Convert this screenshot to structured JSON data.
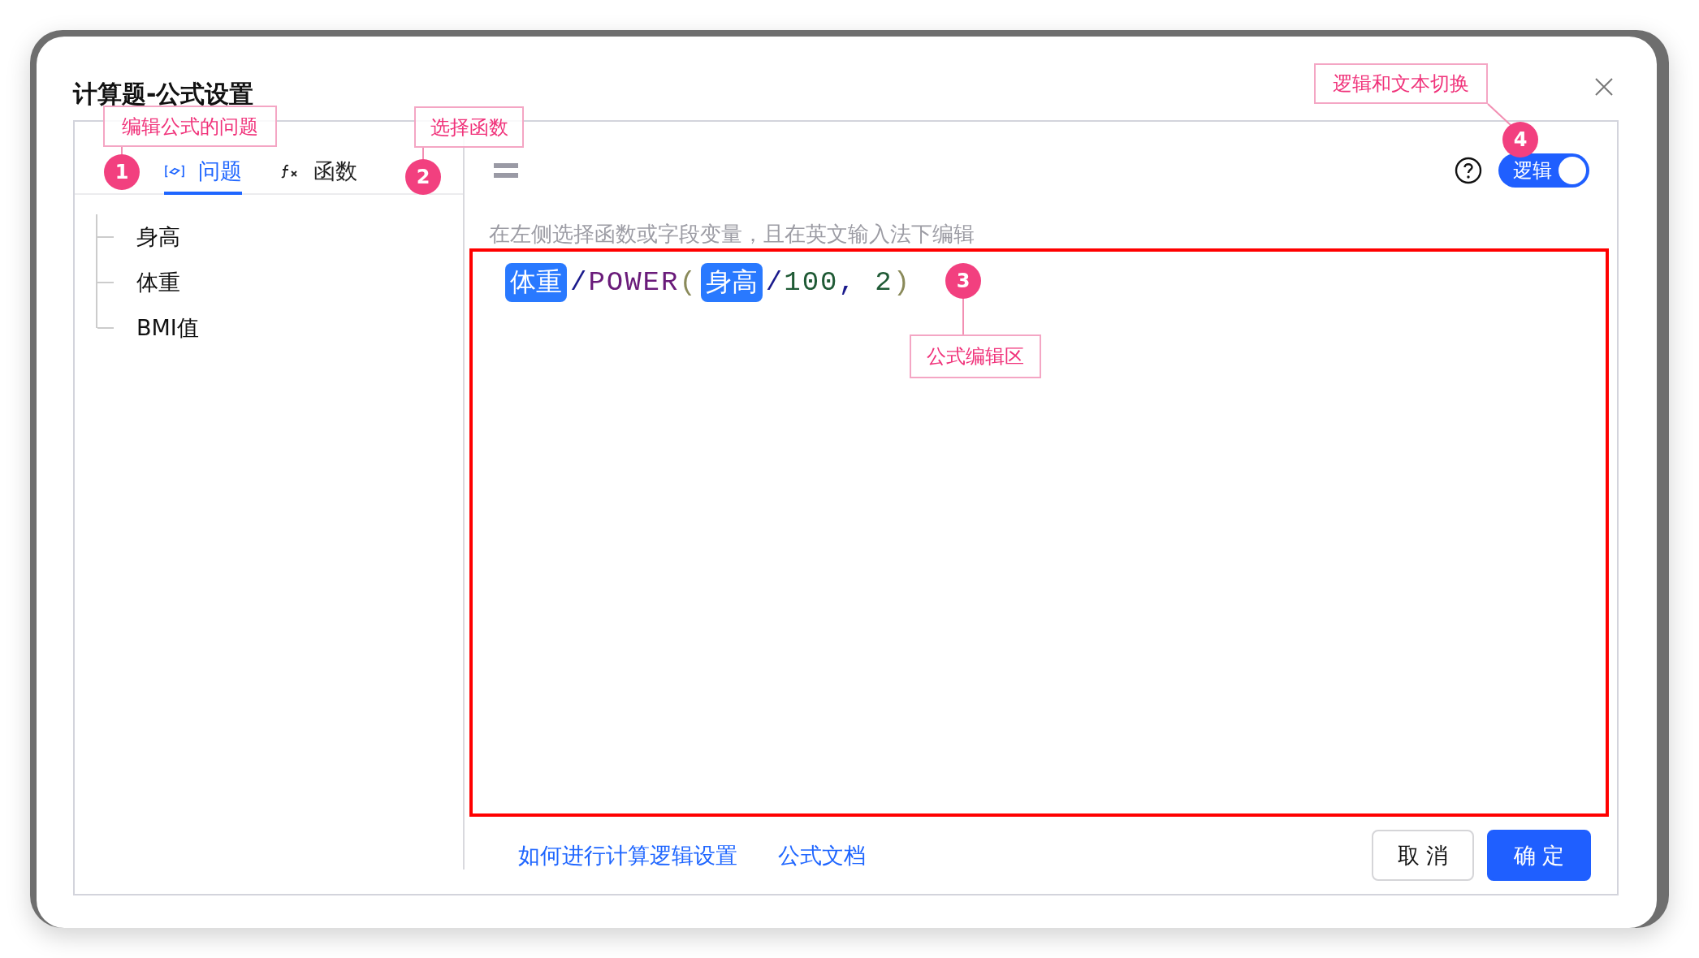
{
  "dialog": {
    "title": "计算题-公式设置"
  },
  "tabs": [
    {
      "label": "问题",
      "kind": "field",
      "selected": true
    },
    {
      "label": "函数",
      "kind": "function",
      "selected": false
    }
  ],
  "tree": {
    "items": [
      "身高",
      "体重",
      "BMI值"
    ]
  },
  "editor": {
    "hint": "在左侧选择函数或字段变量，且在英文输入法下编辑",
    "mode_switch": {
      "label": "逻辑",
      "on": true
    },
    "formula": [
      {
        "kind": "field",
        "text": "体重"
      },
      {
        "kind": "operator",
        "text": "/"
      },
      {
        "kind": "function",
        "text": "POWER"
      },
      {
        "kind": "paren",
        "text": "("
      },
      {
        "kind": "field",
        "text": "身高"
      },
      {
        "kind": "operator",
        "text": "/"
      },
      {
        "kind": "number",
        "text": "100"
      },
      {
        "kind": "operator",
        "text": ", "
      },
      {
        "kind": "number",
        "text": "2"
      },
      {
        "kind": "paren",
        "text": ")"
      }
    ]
  },
  "links": [
    "如何进行计算逻辑设置",
    "公式文档"
  ],
  "buttons": [
    {
      "label": "取 消",
      "kind": "default"
    },
    {
      "label": "确 定",
      "kind": "primary"
    }
  ],
  "annotations": [
    {
      "number": "1",
      "label": "编辑公式的问题"
    },
    {
      "number": "2",
      "label": "选择函数"
    },
    {
      "number": "3",
      "label": "公式编辑区"
    },
    {
      "number": "4",
      "label": "逻辑和文本切换"
    }
  ]
}
